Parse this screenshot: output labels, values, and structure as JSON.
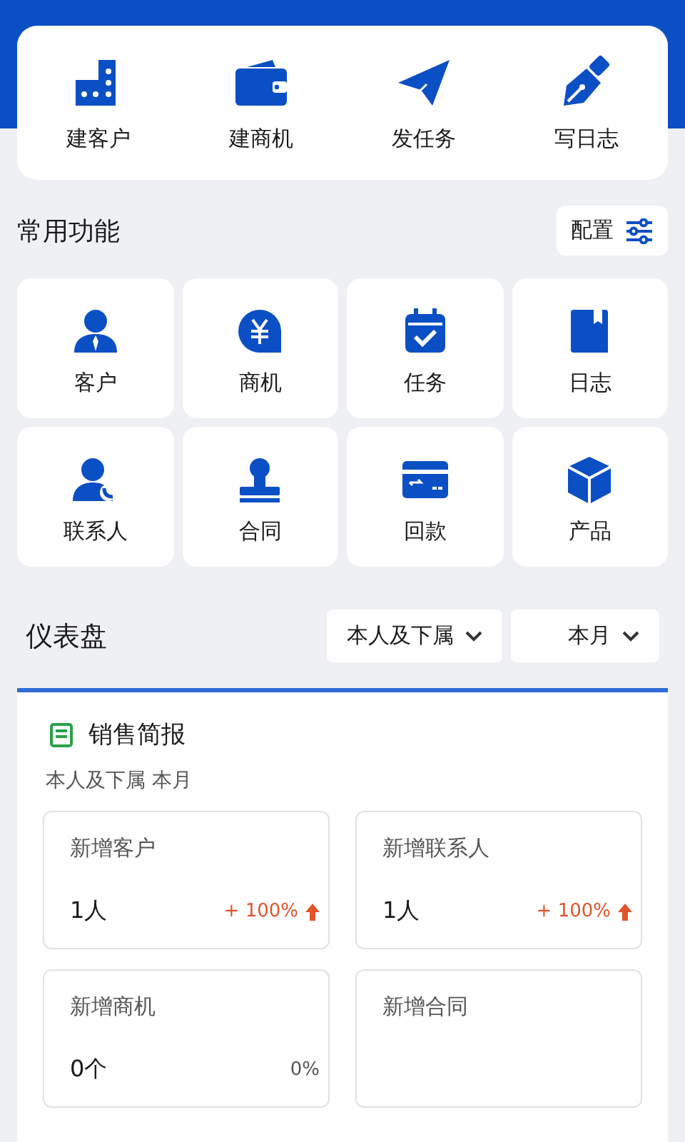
{
  "quick_actions": [
    {
      "label": "建客户"
    },
    {
      "label": "建商机"
    },
    {
      "label": "发任务"
    },
    {
      "label": "写日志"
    }
  ],
  "common": {
    "title": "常用功能",
    "config_button": "配置",
    "items": [
      {
        "label": "客户"
      },
      {
        "label": "商机"
      },
      {
        "label": "任务"
      },
      {
        "label": "日志"
      },
      {
        "label": "联系人"
      },
      {
        "label": "合同"
      },
      {
        "label": "回款"
      },
      {
        "label": "产品"
      }
    ]
  },
  "dashboard": {
    "title": "仪表盘",
    "filters": [
      {
        "label": "本人及下属"
      },
      {
        "label": "本月"
      }
    ],
    "report": {
      "title": "销售简报",
      "subtitle": "本人及下属  本月",
      "stats": [
        {
          "label": "新增客户",
          "value": "1人",
          "change": "+ 100%",
          "rising": true
        },
        {
          "label": "新增联系人",
          "value": "1人",
          "change": "+ 100%",
          "rising": true
        },
        {
          "label": "新增商机",
          "value": "0个",
          "change": "0%",
          "rising": false
        },
        {
          "label": "新增合同"
        }
      ]
    }
  }
}
